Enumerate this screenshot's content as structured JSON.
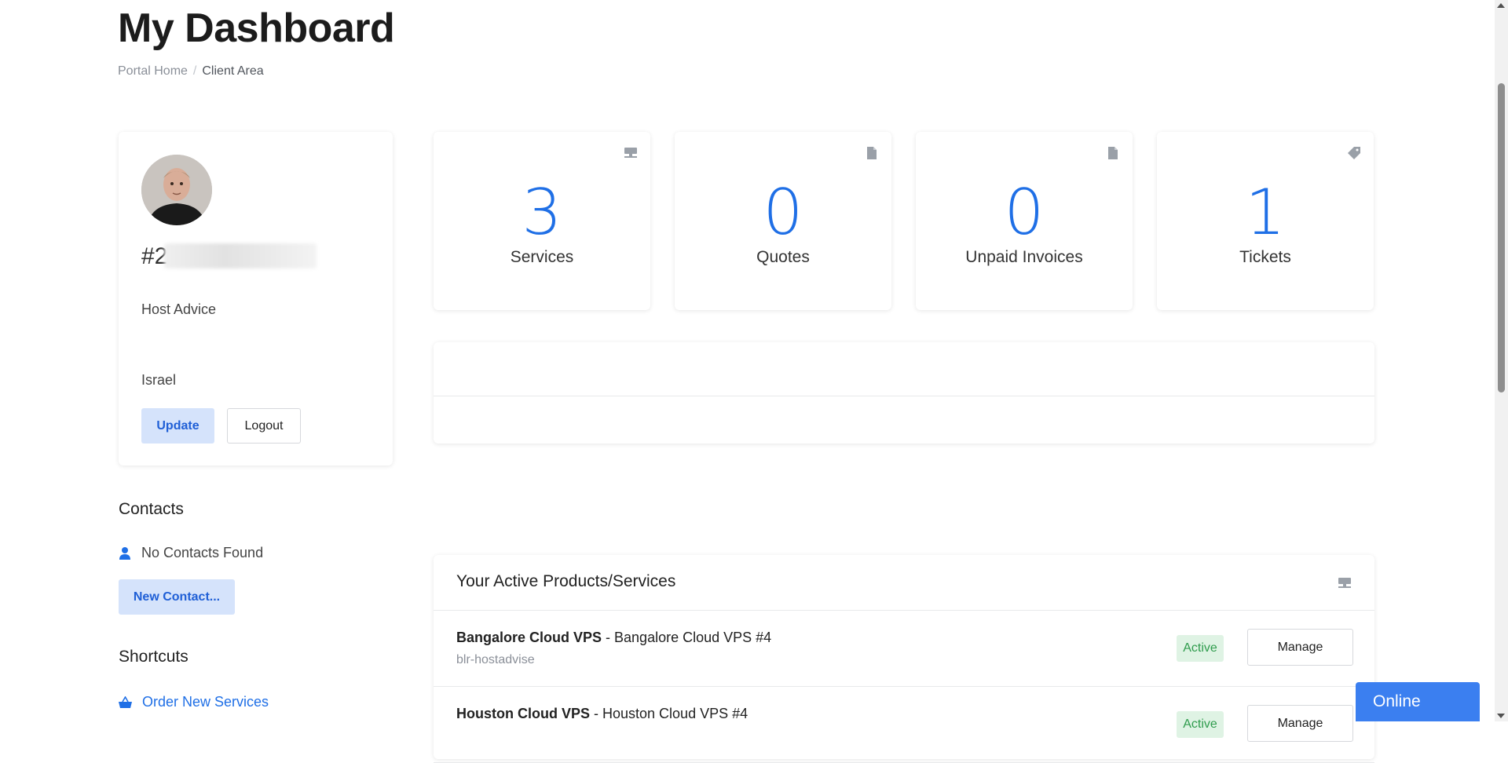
{
  "header": {
    "title": "My Dashboard",
    "breadcrumb": {
      "home": "Portal Home",
      "separator": "/",
      "current": "Client Area"
    }
  },
  "profile": {
    "client_id_prefix": "#2",
    "company": "Host Advice",
    "country": "Israel",
    "update_label": "Update",
    "logout_label": "Logout"
  },
  "stats": [
    {
      "value": "3",
      "label": "Services",
      "icon": "server-icon"
    },
    {
      "value": "0",
      "label": "Quotes",
      "icon": "document-icon"
    },
    {
      "value": "0",
      "label": "Unpaid Invoices",
      "icon": "document-icon"
    },
    {
      "value": "1",
      "label": "Tickets",
      "icon": "tag-icon"
    }
  ],
  "contacts": {
    "title": "Contacts",
    "empty_text": "No Contacts Found",
    "new_contact_label": "New Contact..."
  },
  "shortcuts": {
    "title": "Shortcuts",
    "items": [
      {
        "label": "Order New Services",
        "icon": "basket-icon"
      }
    ]
  },
  "services": {
    "title": "Your Active Products/Services",
    "items": [
      {
        "product": "Bangalore Cloud VPS",
        "separator": " - ",
        "name": "Bangalore Cloud VPS #4",
        "hostname": "blr-hostadvise",
        "status": "Active",
        "action": "Manage"
      },
      {
        "product": "Houston Cloud VPS",
        "separator": " - ",
        "name": "Houston Cloud VPS #4",
        "hostname": "",
        "status": "Active",
        "action": "Manage"
      }
    ]
  },
  "chat": {
    "label": "Online"
  },
  "colors": {
    "accent": "#1f6fe6",
    "accent_light": "#d5e3fb",
    "success_bg": "#dff3e4",
    "success_text": "#2f9c4d",
    "chat_bg": "#3b7ff0"
  }
}
